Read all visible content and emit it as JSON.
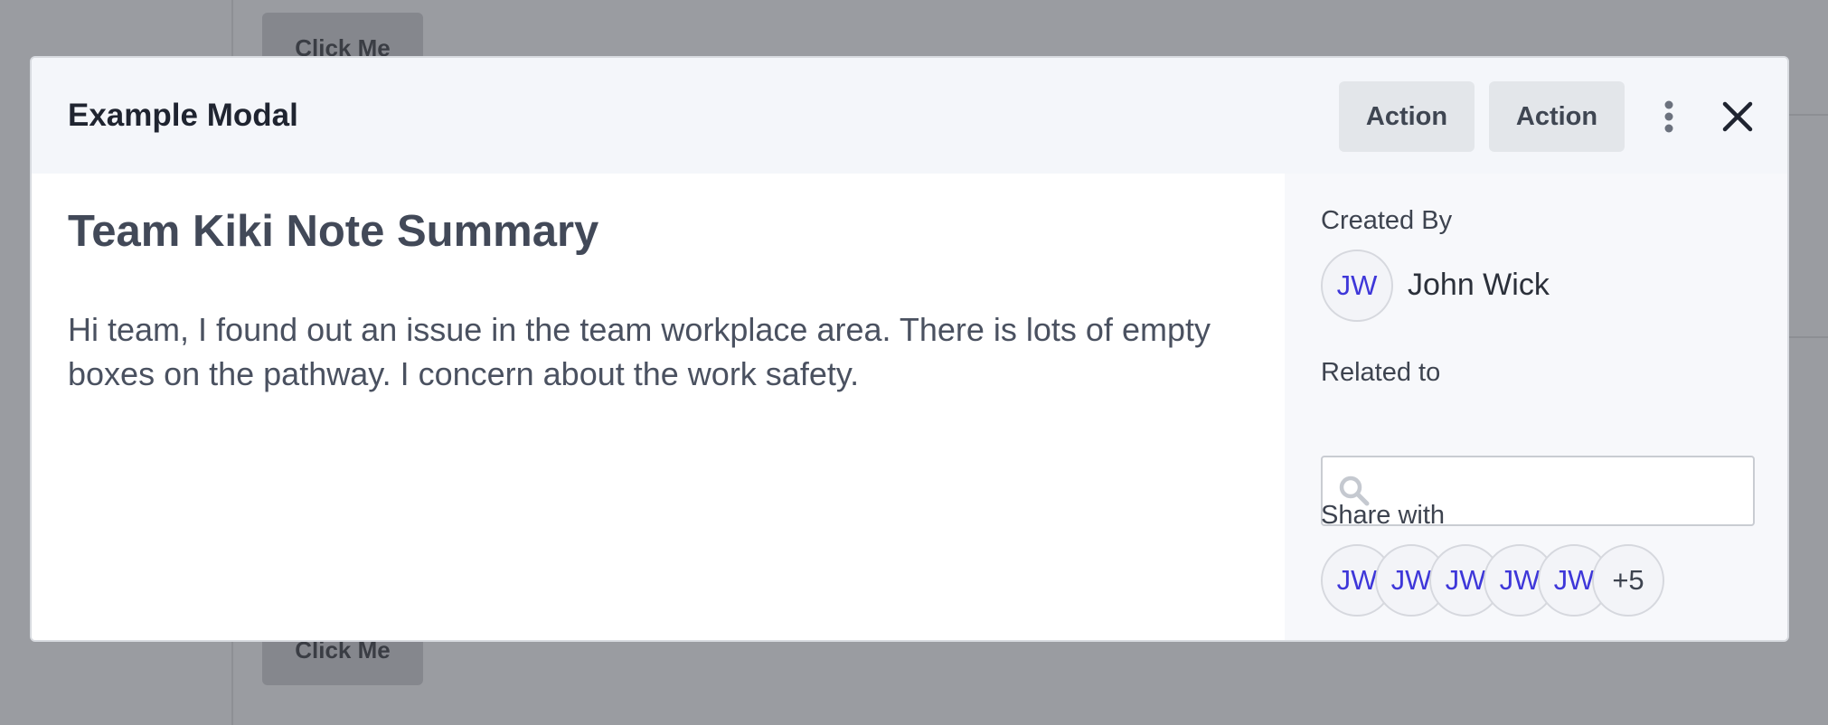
{
  "background": {
    "button_top_label": "Click Me",
    "button_bottom_label": "Click Me"
  },
  "modal": {
    "title": "Example Modal",
    "actions": [
      {
        "label": "Action"
      },
      {
        "label": "Action"
      }
    ],
    "more_icon": "vertical-ellipsis-icon",
    "close_icon": "close-icon"
  },
  "note": {
    "title": "Team Kiki Note Summary",
    "body": "Hi team, I found out an issue in the team workplace area. There is lots of empty boxes on the pathway. I concern about the work safety."
  },
  "sidebar": {
    "created_by_label": "Created By",
    "creator": {
      "initials": "JW",
      "name": "John Wick"
    },
    "related_label": "Related to",
    "related_search": {
      "value": "",
      "placeholder": ""
    },
    "share_label": "Share with",
    "share_avatars": [
      "JW",
      "JW",
      "JW",
      "JW",
      "JW"
    ],
    "share_more": "+5"
  },
  "colors": {
    "avatar_initials": "#3e37d9",
    "header_bg": "#f4f6fa",
    "overlay": "#9a9ca1"
  }
}
